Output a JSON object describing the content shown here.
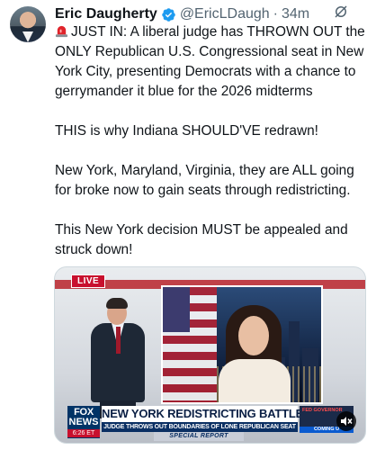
{
  "post": {
    "author_name": "Eric Daugherty",
    "handle": "@EricLDaugh",
    "separator": "·",
    "time": "34m",
    "more_label": "···",
    "paragraphs": [
      "JUST IN: A liberal judge has THROWN OUT the ONLY Republican U.S. Congressional seat in New York City, presenting Democrats with a chance to gerrymander it blue for the 2026 midterms",
      "THIS is why Indiana SHOULD'VE redrawn!",
      "New York, Maryland, Virginia, they are ALL going for broke now to gain seats through redistricting.",
      "This New York decision MUST be appealed and struck down!"
    ]
  },
  "media": {
    "live_label": "LIVE",
    "network_line1": "FOX",
    "network_line2": "NEWS",
    "clock": "6:26 ET",
    "headline": "NEW YORK REDISTRICTING BATTLE",
    "subhead": "JUDGE THROWS OUT BOUNDARIES OF LONE REPUBLICAN SEAT",
    "special": "SPECIAL REPORT",
    "ticker_line1": "FED GOVERNOR",
    "ticker_line2": "COMING U"
  },
  "icons": {
    "verified": "verified-badge-icon",
    "grok": "grok-icon",
    "siren": "rotating-light-icon",
    "speaker": "speaker-muted-icon"
  },
  "colors": {
    "verified_blue": "#1d9bf0",
    "text": "#0f1419",
    "secondary": "#536471"
  }
}
